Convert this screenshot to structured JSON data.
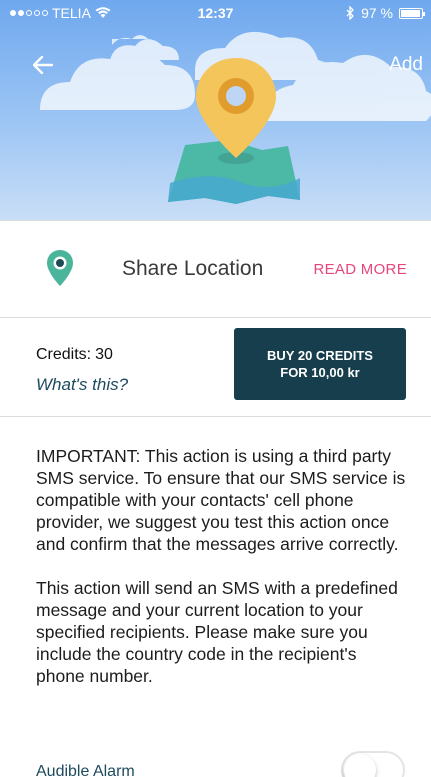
{
  "status_bar": {
    "carrier": "TELIA",
    "time": "12:37",
    "battery": "97 %",
    "battery_level": 0.97
  },
  "header": {
    "back_icon": "arrow-left-icon",
    "add_label": "Add"
  },
  "action": {
    "icon": "location-pin-icon",
    "title": "Share Location",
    "read_more": "READ MORE"
  },
  "credits": {
    "label": "Credits:",
    "value": "30",
    "whats_this": "What's this?",
    "buy_line1": "BUY 20 CREDITS",
    "buy_line2": "FOR 10,00 kr"
  },
  "info": {
    "paragraph1": "IMPORTANT: This action is using a third party SMS service. To ensure that our SMS service is compatible with your contacts' cell phone provider, we suggest you test this action once and confirm that the messages arrive correctly.",
    "paragraph2": "This action will send an SMS with a predefined message and your current location to your specified recipients. Please make sure you include the country code in the recipient's phone number."
  },
  "alarm": {
    "label": "Audible Alarm",
    "enabled": false
  },
  "colors": {
    "accent": "#e8457a",
    "button_bg": "#173e4c",
    "link": "#1e4a5e",
    "pin": "#4bb59b",
    "sky": "#8fbcf2"
  }
}
